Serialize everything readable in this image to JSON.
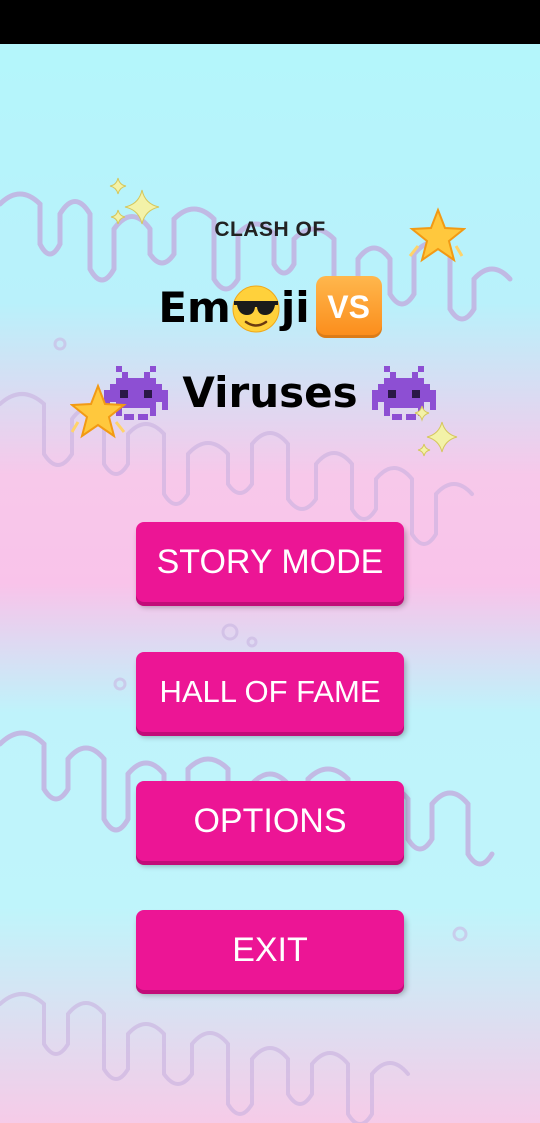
{
  "title": {
    "small": "CLASH OF",
    "line1_part1": "Em",
    "line1_part2": "ji",
    "vs": "VS",
    "line2": "Viruses"
  },
  "menu": {
    "story_mode": "STORY MODE",
    "hall_of_fame": "HALL OF FAME",
    "options": "OPTIONS",
    "exit": "EXIT"
  },
  "icons": [
    "sunglasses-face-icon",
    "vs-badge-icon",
    "alien-monster-icon",
    "sparkles-icon",
    "glowing-star-icon"
  ],
  "colors": {
    "button": "#ec1595",
    "button_shadow": "#c20c79",
    "bg_cyan": "#b4f6fb",
    "bg_pink": "#f9c3ea",
    "vs_orange": "#fb8c1a",
    "alien_purple": "#8d4fd3"
  }
}
